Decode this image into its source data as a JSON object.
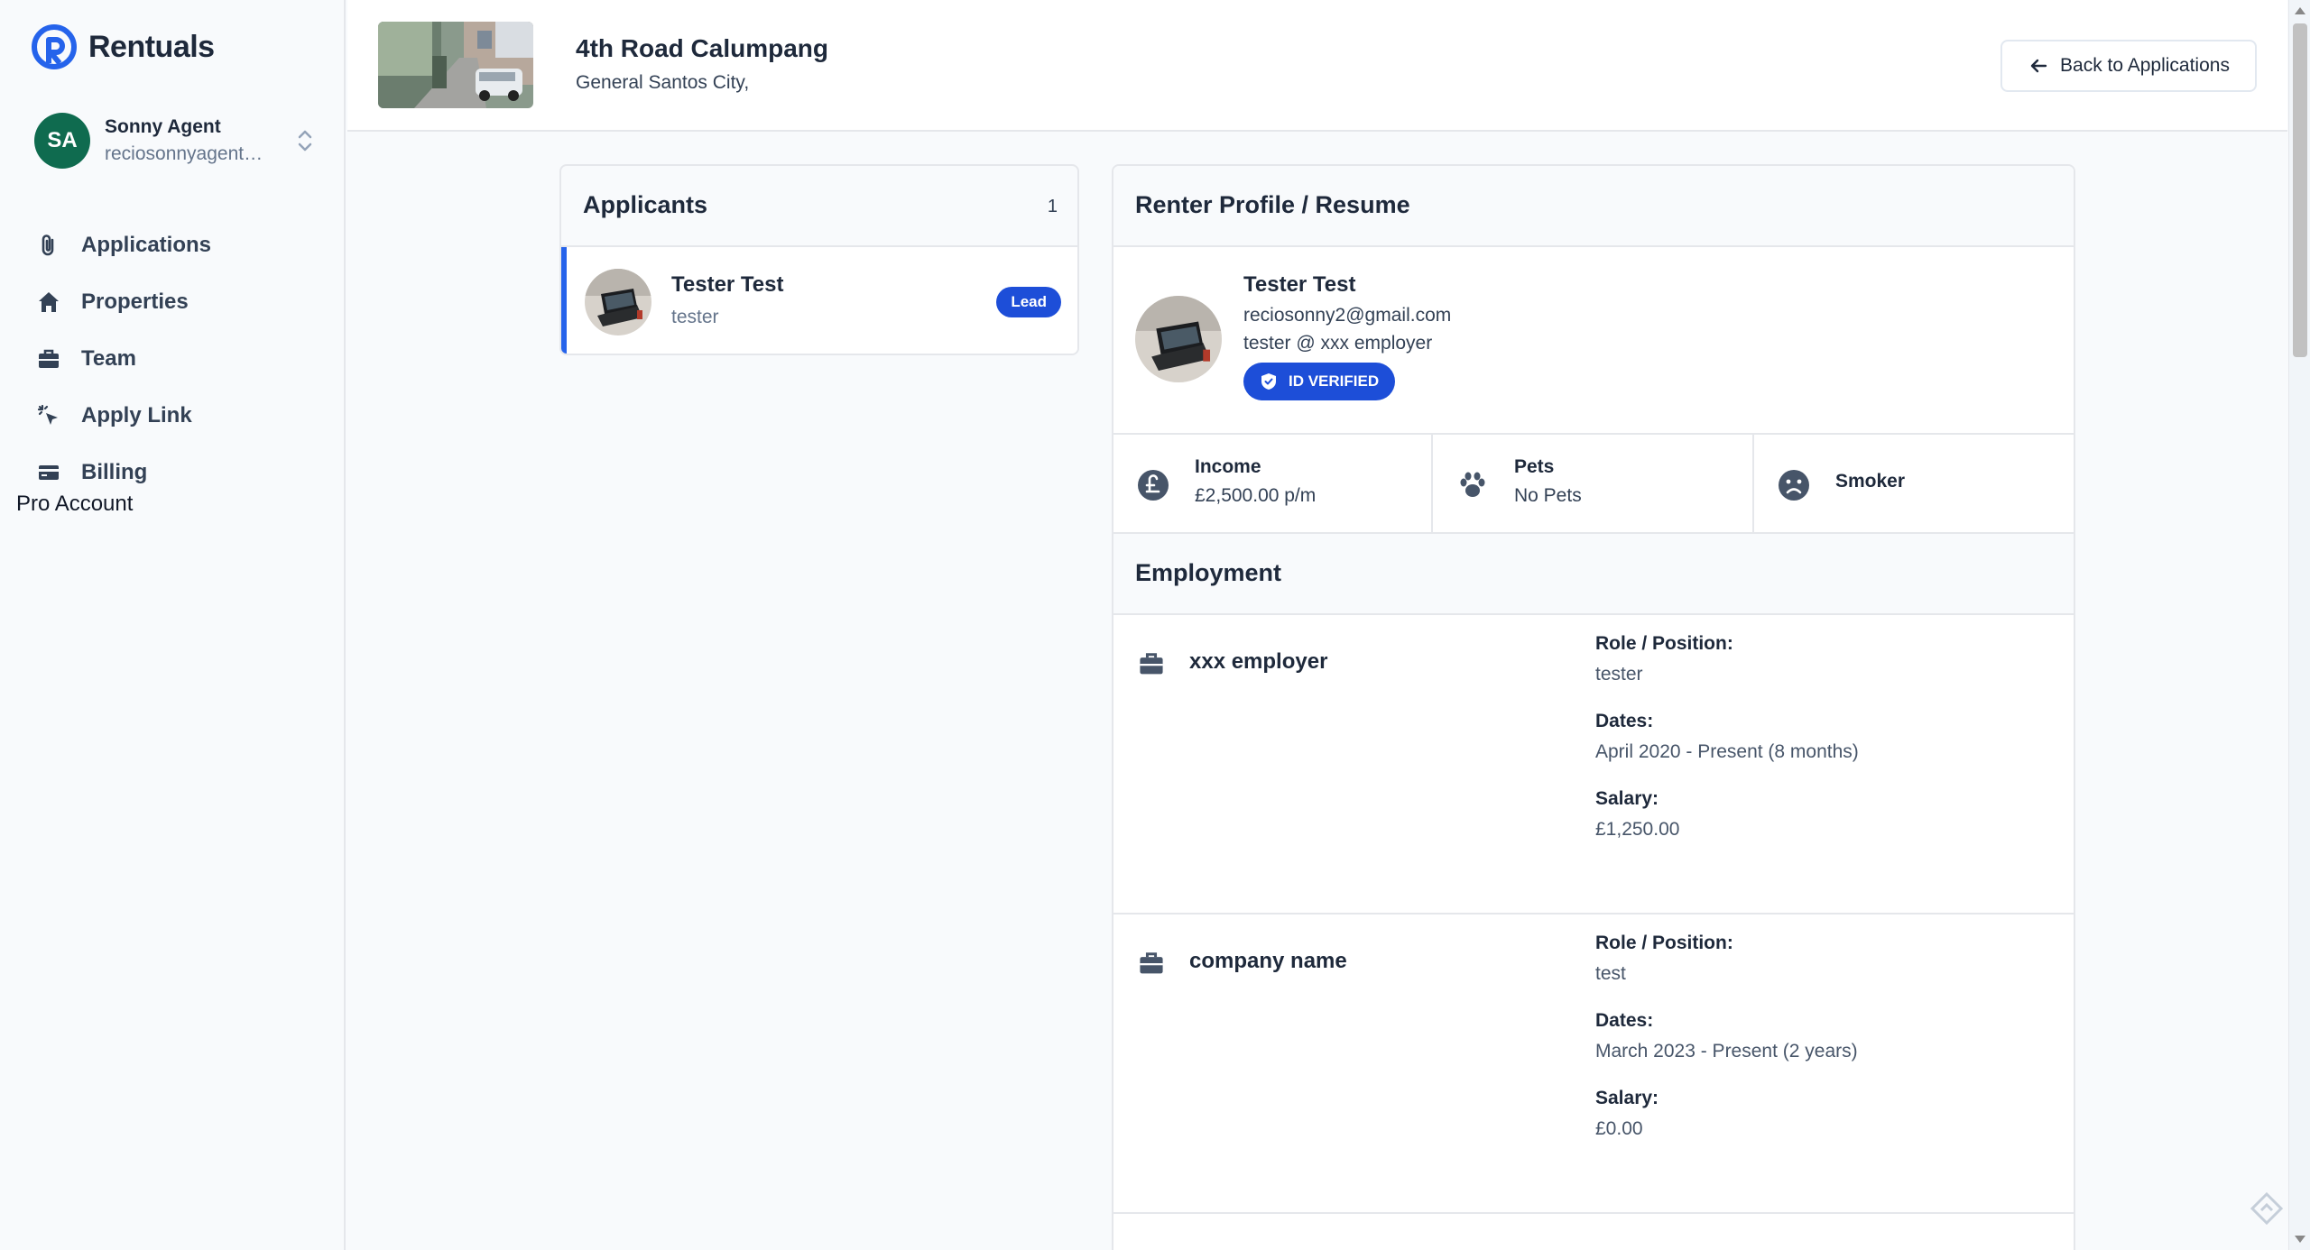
{
  "brand": {
    "name": "Rentuals",
    "color": "#2563eb"
  },
  "user": {
    "initials": "SA",
    "name": "Sonny Agent",
    "email": "reciosonnyagent@gmail.com",
    "avatar_color": "#0f6b4f"
  },
  "sidebar": {
    "items": [
      {
        "label": "Applications",
        "icon": "paperclip-icon"
      },
      {
        "label": "Properties",
        "icon": "home-icon"
      },
      {
        "label": "Team",
        "icon": "briefcase-icon"
      },
      {
        "label": "Apply Link",
        "icon": "cursor-click-icon"
      },
      {
        "label": "Billing",
        "icon": "credit-card-icon"
      }
    ],
    "plan": "Pro Account"
  },
  "header": {
    "property_title": "4th Road Calumpang",
    "property_subtitle": "General Santos City,",
    "back_label": "Back to Applications"
  },
  "applicants": {
    "title": "Applicants",
    "count": "1",
    "list": [
      {
        "name": "Tester Test",
        "role": "tester",
        "badge": "Lead"
      }
    ]
  },
  "profile": {
    "title": "Renter Profile / Resume",
    "name": "Tester Test",
    "email": "reciosonny2@gmail.com",
    "job": "tester @ xxx employer",
    "verified_label": "ID VERIFIED",
    "stats": {
      "income_label": "Income",
      "income_value": "£2,500.00 p/m",
      "pets_label": "Pets",
      "pets_value": "No Pets",
      "smoker_label": "Smoker"
    }
  },
  "employment": {
    "title": "Employment",
    "labels": {
      "role": "Role / Position:",
      "dates": "Dates:",
      "salary": "Salary:"
    },
    "jobs": [
      {
        "company": "xxx employer",
        "role": "tester",
        "dates": "April 2020 - Present (8 months)",
        "salary": "£1,250.00"
      },
      {
        "company": "company name",
        "role": "test",
        "dates": "March 2023 - Present (2 years)",
        "salary": "£0.00"
      }
    ]
  },
  "colors": {
    "accent": "#1d4ed8",
    "sidebar_bg": "#f8fafc",
    "text": "#1e293b"
  }
}
